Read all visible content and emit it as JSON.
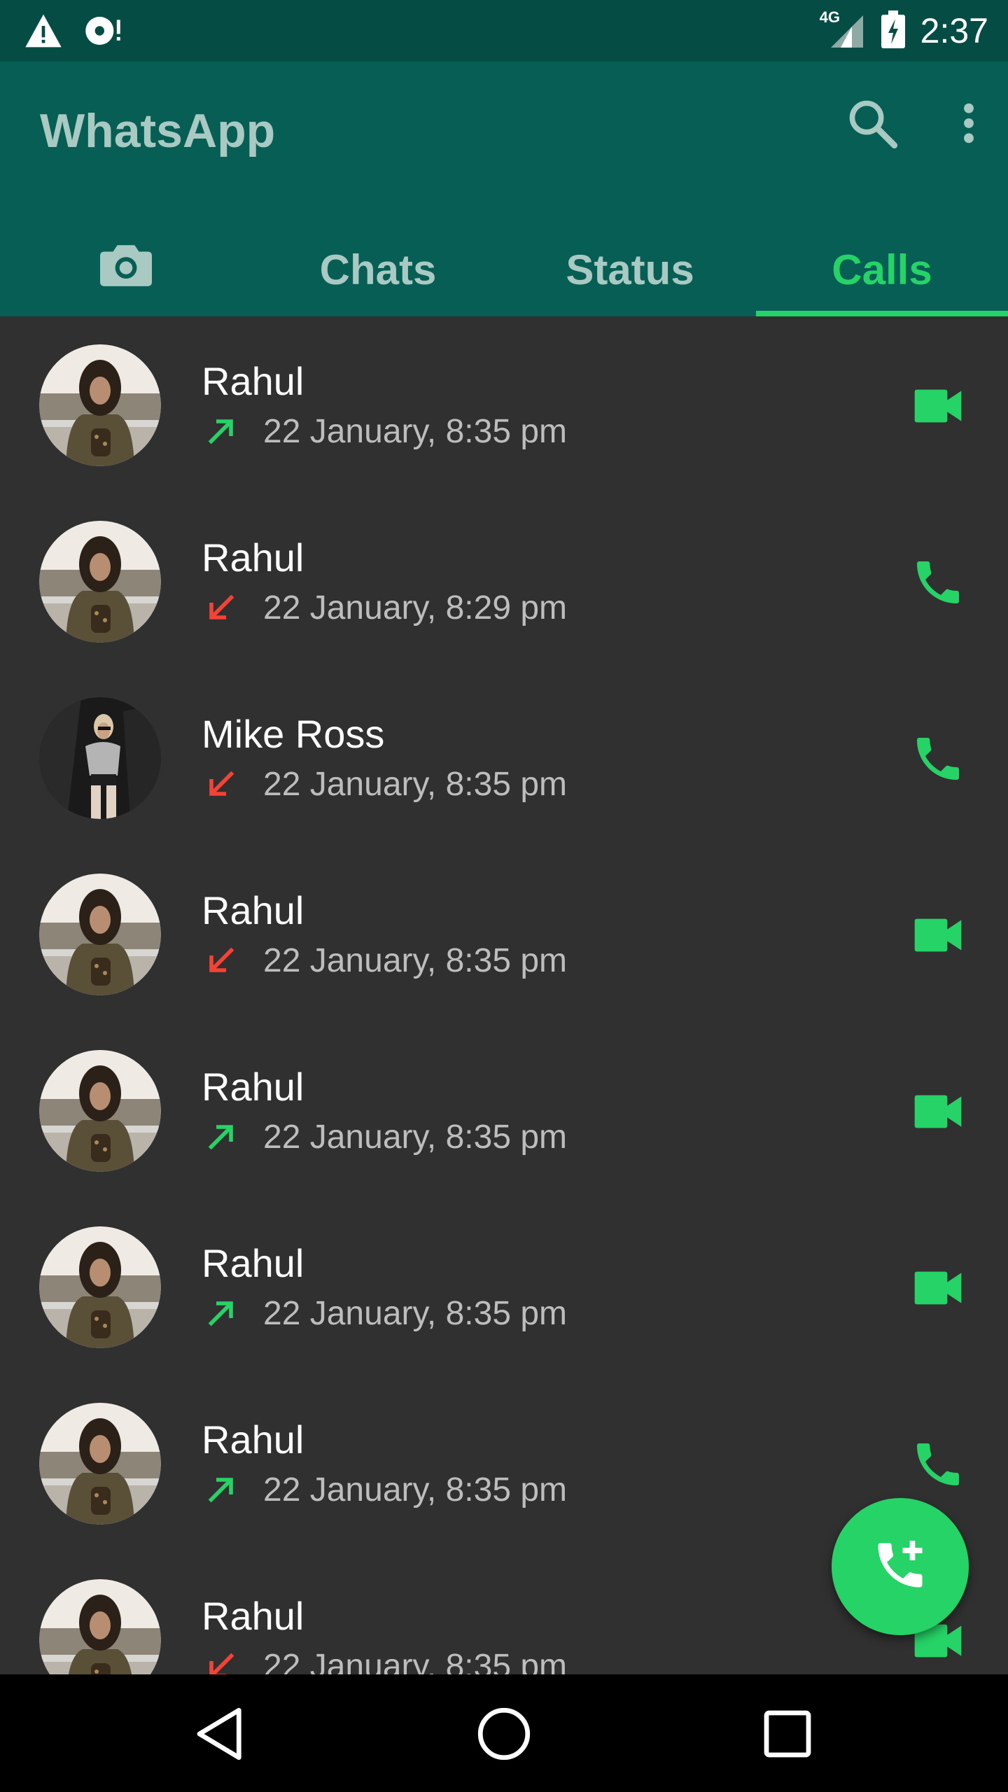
{
  "status_bar": {
    "time": "2:37",
    "network": "4G",
    "icons": [
      "warning-icon",
      "sync-alert-icon",
      "signal-icon",
      "battery-charging-icon"
    ]
  },
  "app_bar": {
    "title": "WhatsApp",
    "actions": [
      "search-icon",
      "more-vert-icon"
    ]
  },
  "tabs": [
    {
      "id": "camera",
      "icon": "camera-icon",
      "label": ""
    },
    {
      "id": "chats",
      "label": "Chats"
    },
    {
      "id": "status",
      "label": "Status"
    },
    {
      "id": "calls",
      "label": "Calls",
      "active": true
    }
  ],
  "calls": [
    {
      "name": "Rahul",
      "time": "22 January, 8:35 pm",
      "direction": "outgoing",
      "type": "video"
    },
    {
      "name": "Rahul",
      "time": "22 January, 8:29 pm",
      "direction": "missed",
      "type": "voice"
    },
    {
      "name": "Mike Ross",
      "time": "22 January, 8:35 pm",
      "direction": "missed",
      "type": "voice"
    },
    {
      "name": "Rahul",
      "time": "22 January, 8:35 pm",
      "direction": "missed",
      "type": "video"
    },
    {
      "name": "Rahul",
      "time": "22 January, 8:35 pm",
      "direction": "outgoing",
      "type": "video"
    },
    {
      "name": "Rahul",
      "time": "22 January, 8:35 pm",
      "direction": "outgoing",
      "type": "video"
    },
    {
      "name": "Rahul",
      "time": "22 January, 8:35 pm",
      "direction": "outgoing",
      "type": "voice"
    },
    {
      "name": "Rahul",
      "time": "22 January, 8:35 pm",
      "direction": "missed",
      "type": "video"
    }
  ],
  "fab": {
    "icon": "add-call-icon"
  },
  "nav_bar": {
    "buttons": [
      "back-icon",
      "home-icon",
      "recents-icon"
    ]
  },
  "colors": {
    "status_bar": "#054D44",
    "app_bar": "#075E54",
    "accent": "#25D366",
    "missed": "#F44336",
    "list_bg": "#303030",
    "tab_inactive": "#A9C9C3"
  }
}
